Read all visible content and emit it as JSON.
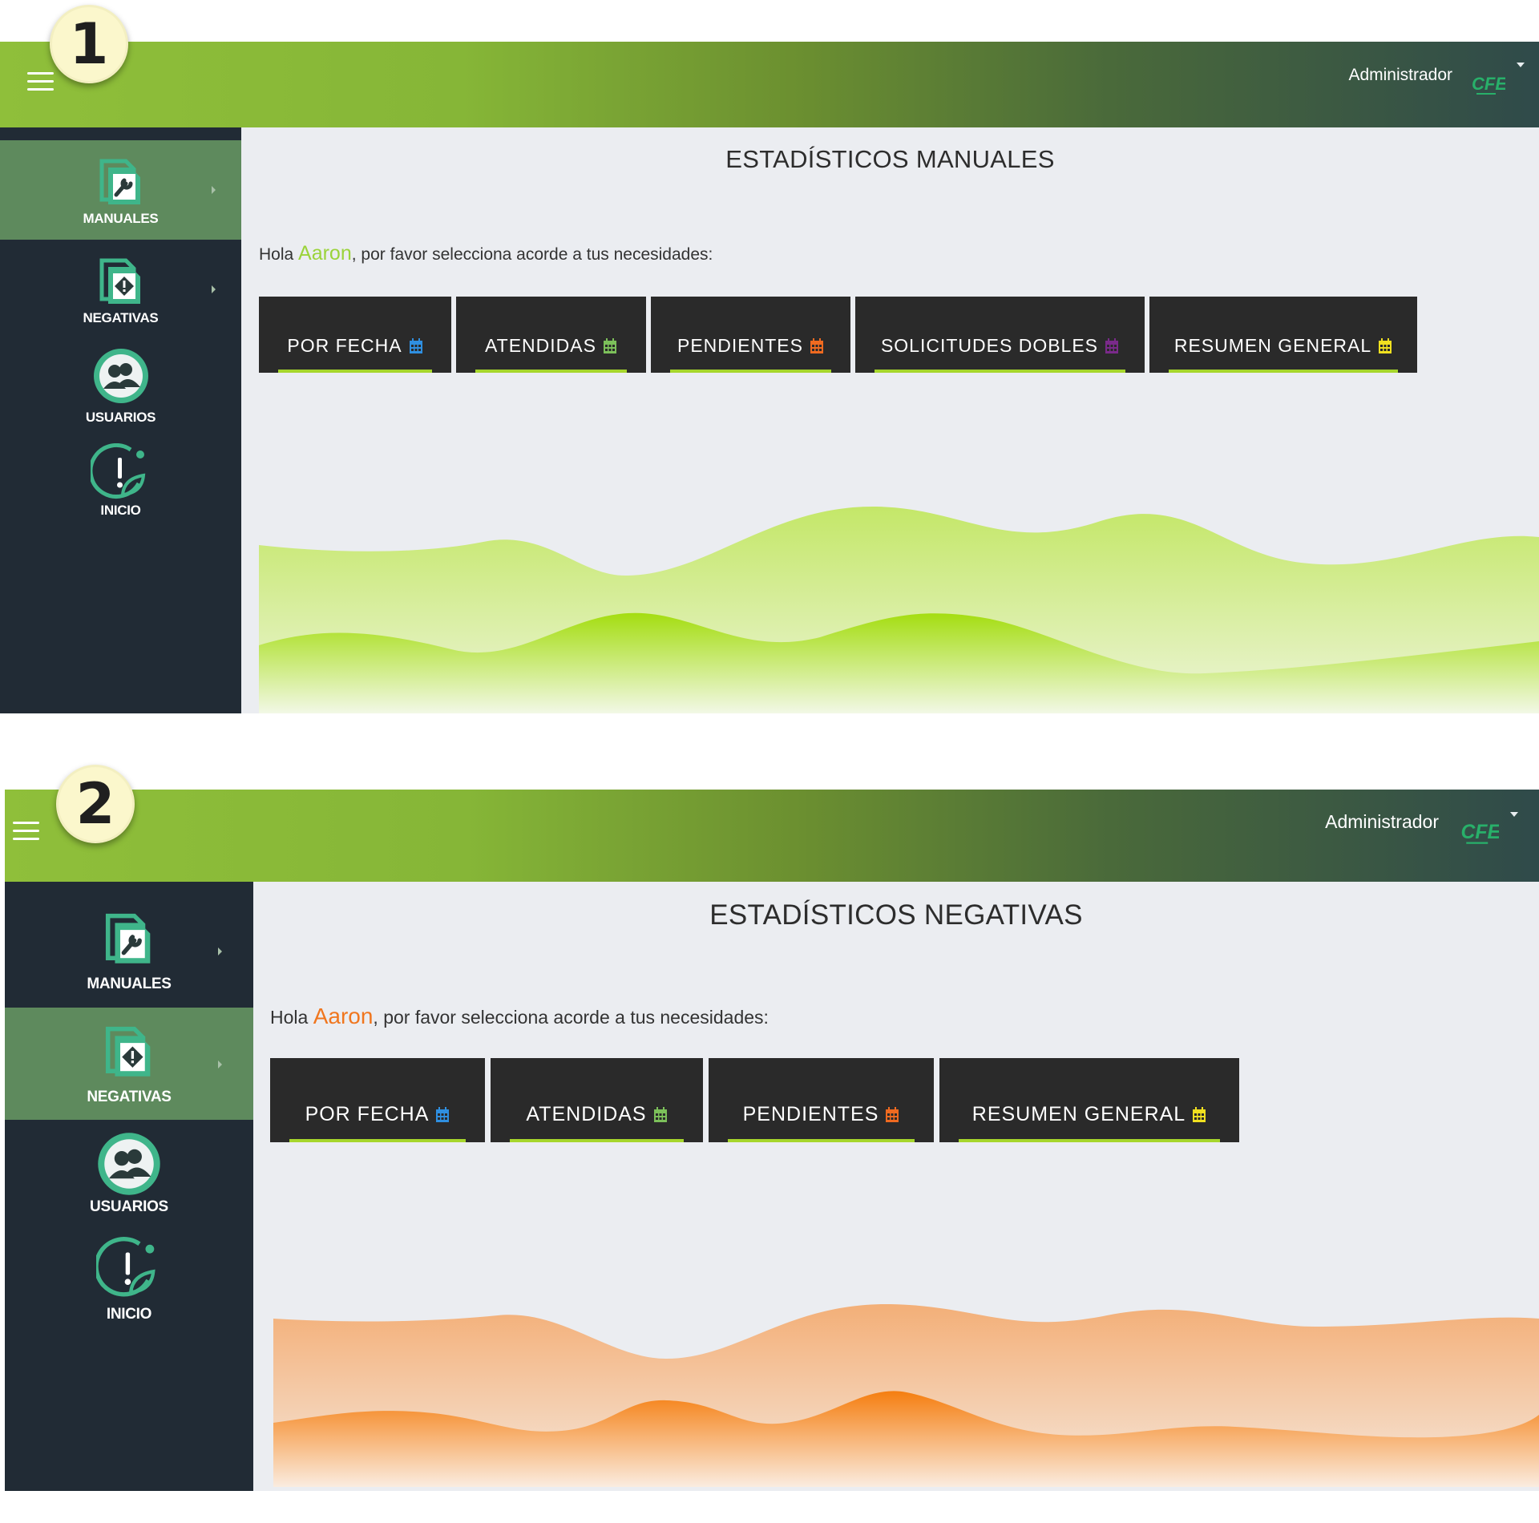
{
  "screens": [
    {
      "step_number": "1",
      "admin_label": "Administrador",
      "logo_text": "CFE",
      "nav": [
        {
          "label": "MANUALES",
          "active": true
        },
        {
          "label": "NEGATIVAS",
          "active": false
        },
        {
          "label": "USUARIOS",
          "active": false
        },
        {
          "label": "INICIO",
          "active": false
        }
      ],
      "title": "ESTADÍSTICOS MANUALES",
      "greeting_prefix": "Hola ",
      "user_name": "Aaron",
      "greeting_suffix": ", por favor selecciona acorde a tus necesidades:",
      "name_color": "#9bd33a",
      "tabs": [
        {
          "label": "POR FECHA",
          "icon_color": "#2f8fe0"
        },
        {
          "label": "ATENDIDAS",
          "icon_color": "#7cc05a"
        },
        {
          "label": "PENDIENTES",
          "icon_color": "#ef6a20"
        },
        {
          "label": "SOLICITUDES DOBLES",
          "icon_color": "#7a2a8a"
        },
        {
          "label": "RESUMEN GENERAL",
          "icon_color": "#f0e020"
        }
      ],
      "wave_color": "#a8dd1a"
    },
    {
      "step_number": "2",
      "admin_label": "Administrador",
      "logo_text": "CFE",
      "nav": [
        {
          "label": "MANUALES",
          "active": false
        },
        {
          "label": "NEGATIVAS",
          "active": true
        },
        {
          "label": "USUARIOS",
          "active": false
        },
        {
          "label": "INICIO",
          "active": false
        }
      ],
      "title": "ESTADÍSTICOS NEGATIVAS",
      "greeting_prefix": "Hola ",
      "user_name": "Aaron",
      "greeting_suffix": ", por favor selecciona acorde a tus necesidades:",
      "name_color": "#f0761e",
      "tabs": [
        {
          "label": "POR FECHA",
          "icon_color": "#2f8fe0"
        },
        {
          "label": "ATENDIDAS",
          "icon_color": "#7cc05a"
        },
        {
          "label": "PENDIENTES",
          "icon_color": "#ef6a20"
        },
        {
          "label": "RESUMEN GENERAL",
          "icon_color": "#f0e020"
        }
      ],
      "wave_color": "#f68a2a"
    }
  ],
  "colors": {
    "sidebar_bg": "#212b35",
    "sidebar_active": "#5e8a5d",
    "tab_bg": "#2a2a2a",
    "tab_underline": "#a6d62c",
    "content_bg": "#ebedf1",
    "icon_teal": "#3fb58a"
  }
}
